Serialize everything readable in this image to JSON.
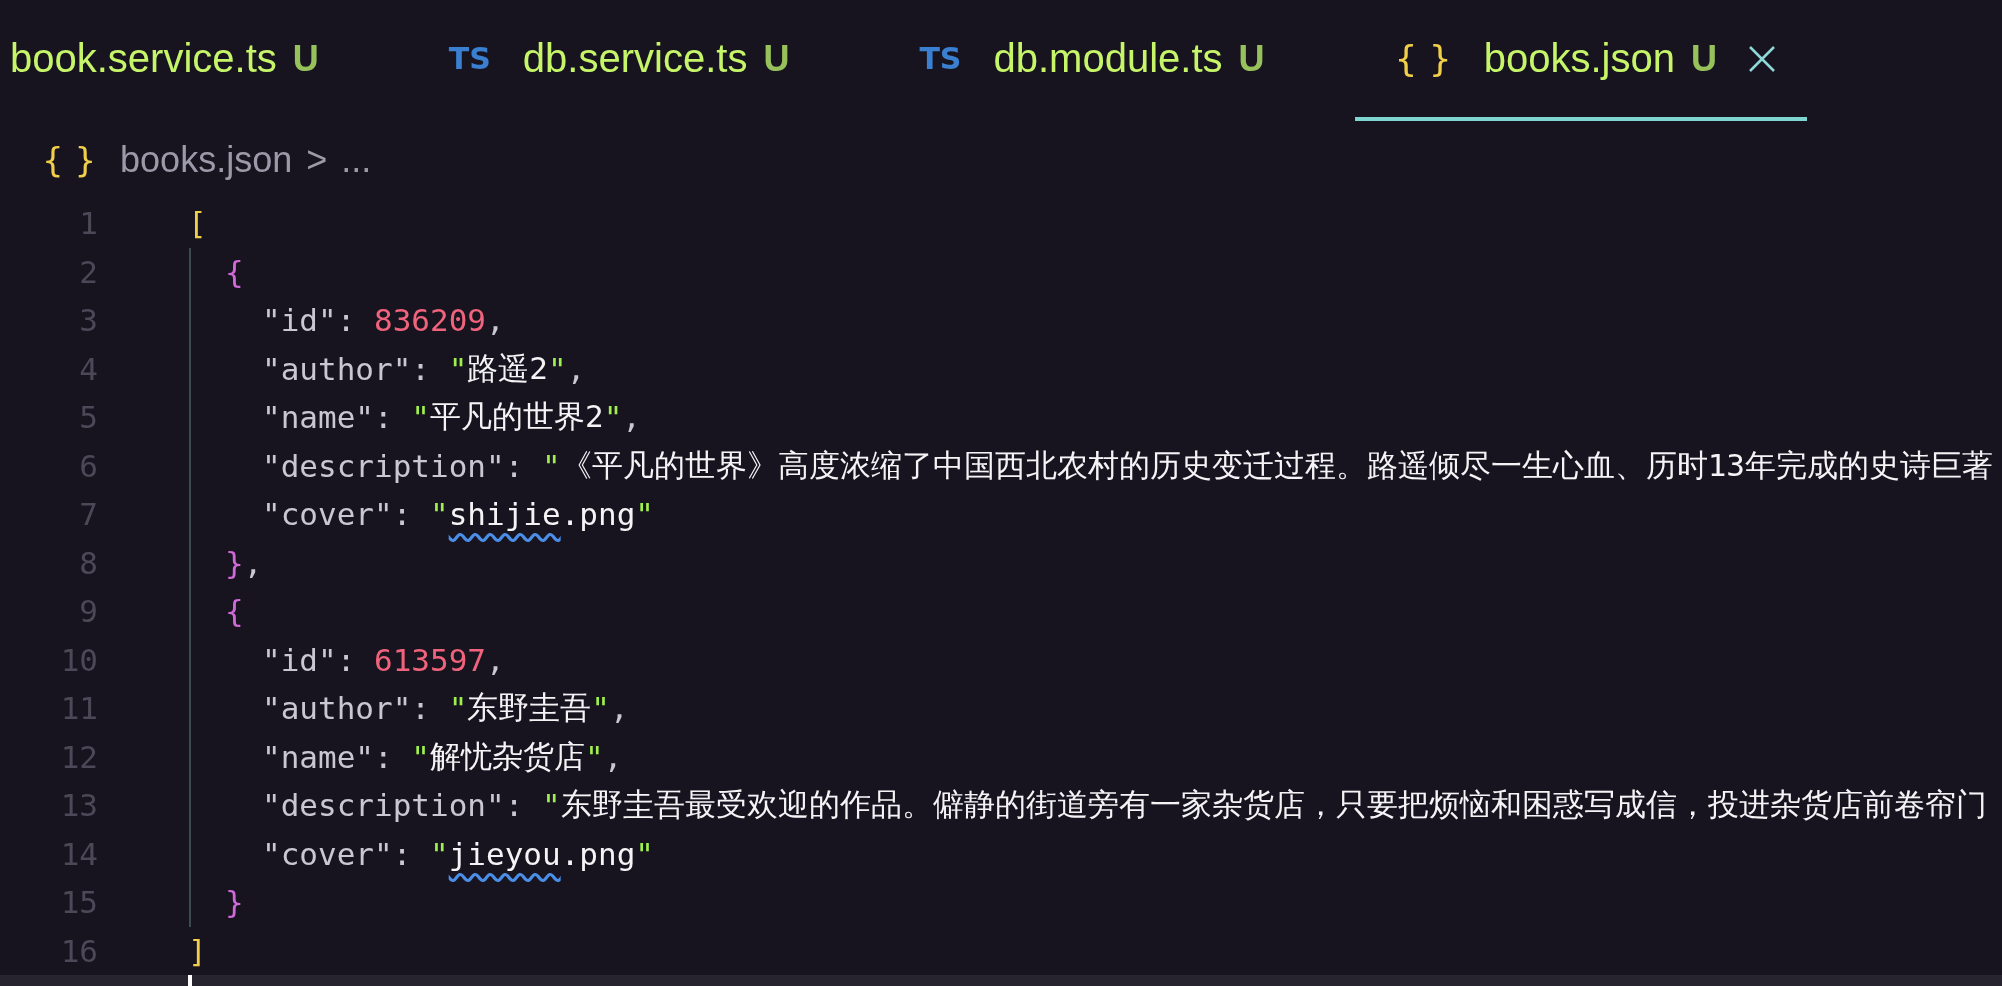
{
  "tabs": [
    {
      "kind": "plain",
      "label": "book.service.ts",
      "badge": "U",
      "selected": false
    },
    {
      "kind": "ts",
      "icon": "TS",
      "label": "db.service.ts",
      "badge": "U",
      "selected": false
    },
    {
      "kind": "ts",
      "icon": "TS",
      "label": "db.module.ts",
      "badge": "U",
      "selected": false
    },
    {
      "kind": "json",
      "icon": "{ }",
      "label": "books.json",
      "badge": "U",
      "selected": true
    }
  ],
  "breadcrumb": {
    "icon": "{ }",
    "file": "books.json",
    "separator": ">",
    "more": "..."
  },
  "code": [
    {
      "kind": "code",
      "number": "1",
      "tokens": [
        {
          "kind": "bracket_outer",
          "text": "["
        }
      ],
      "guide": true,
      "children": [
        {
          "kind": "code",
          "number": "2",
          "tokens": [
            {
              "kind": "bracket_inner",
              "text": "{"
            }
          ],
          "guide": false,
          "children": [
            {
              "kind": "code",
              "number": "3",
              "tokens": [
                {
                  "kind": "key",
                  "text": "\"id\""
                },
                {
                  "kind": "plain",
                  "text": ":"
                },
                {
                  "kind": "number",
                  "text": "836209"
                },
                {
                  "kind": "plain",
                  "text": ","
                }
              ]
            },
            {
              "kind": "code",
              "number": "4",
              "tokens": [
                {
                  "kind": "key",
                  "text": "\"author\""
                },
                {
                  "kind": "plain",
                  "text": ":"
                },
                {
                  "kind": "quote",
                  "text": "\""
                },
                {
                  "kind": "string",
                  "text": "路遥2"
                },
                {
                  "kind": "quote",
                  "text": "\""
                },
                {
                  "kind": "plain",
                  "text": ","
                }
              ]
            },
            {
              "kind": "code",
              "number": "5",
              "tokens": [
                {
                  "kind": "key",
                  "text": "\"name\""
                },
                {
                  "kind": "plain",
                  "text": ":"
                },
                {
                  "kind": "quote",
                  "text": "\""
                },
                {
                  "kind": "string",
                  "text": "平凡的世界2"
                },
                {
                  "kind": "quote",
                  "text": "\""
                },
                {
                  "kind": "plain",
                  "text": ","
                }
              ]
            },
            {
              "kind": "code",
              "number": "6",
              "tokens": [
                {
                  "kind": "key",
                  "text": "\"description\""
                },
                {
                  "kind": "plain",
                  "text": ":"
                },
                {
                  "kind": "quote",
                  "text": "\""
                },
                {
                  "kind": "string",
                  "text": "《平凡的世界》高度浓缩了中国西北农村的历史变迁过程。路遥倾尽一生心血、历时13年完成的史诗巨著"
                }
              ]
            },
            {
              "kind": "code",
              "number": "7",
              "tokens": [
                {
                  "kind": "key",
                  "text": "\"cover\""
                },
                {
                  "kind": "plain",
                  "text": ":"
                },
                {
                  "kind": "quote",
                  "text": "\""
                },
                {
                  "kind": "flagged",
                  "text": "shijie"
                },
                {
                  "kind": "string",
                  "text": ".png"
                },
                {
                  "kind": "quote",
                  "text": "\""
                }
              ]
            }
          ]
        },
        {
          "kind": "code",
          "number": "8",
          "tokens": [
            {
              "kind": "bracket_inner",
              "text": "}"
            },
            {
              "kind": "plain",
              "text": ","
            }
          ]
        },
        {
          "kind": "code",
          "number": "9",
          "tokens": [
            {
              "kind": "bracket_inner",
              "text": "{"
            }
          ],
          "guide": false,
          "children": [
            {
              "kind": "code",
              "number": "10",
              "tokens": [
                {
                  "kind": "key",
                  "text": "\"id\""
                },
                {
                  "kind": "plain",
                  "text": ":"
                },
                {
                  "kind": "number",
                  "text": "613597"
                },
                {
                  "kind": "plain",
                  "text": ","
                }
              ]
            },
            {
              "kind": "code",
              "number": "11",
              "tokens": [
                {
                  "kind": "key",
                  "text": "\"author\""
                },
                {
                  "kind": "plain",
                  "text": ":"
                },
                {
                  "kind": "quote",
                  "text": "\""
                },
                {
                  "kind": "string",
                  "text": "东野圭吾"
                },
                {
                  "kind": "quote",
                  "text": "\""
                },
                {
                  "kind": "plain",
                  "text": ","
                }
              ]
            },
            {
              "kind": "code",
              "number": "12",
              "tokens": [
                {
                  "kind": "key",
                  "text": "\"name\""
                },
                {
                  "kind": "plain",
                  "text": ":"
                },
                {
                  "kind": "quote",
                  "text": "\""
                },
                {
                  "kind": "string",
                  "text": "解忧杂货店"
                },
                {
                  "kind": "quote",
                  "text": "\""
                },
                {
                  "kind": "plain",
                  "text": ","
                }
              ]
            },
            {
              "kind": "code",
              "number": "13",
              "tokens": [
                {
                  "kind": "key",
                  "text": "\"description\""
                },
                {
                  "kind": "plain",
                  "text": ":"
                },
                {
                  "kind": "quote",
                  "text": "\""
                },
                {
                  "kind": "string",
                  "text": "东野圭吾最受欢迎的作品。僻静的街道旁有一家杂货店，只要把烦恼和困惑写成信，投进杂货店前卷帘门"
                }
              ]
            },
            {
              "kind": "code",
              "number": "14",
              "tokens": [
                {
                  "kind": "key",
                  "text": "\"cover\""
                },
                {
                  "kind": "plain",
                  "text": ":"
                },
                {
                  "kind": "quote",
                  "text": "\""
                },
                {
                  "kind": "flagged",
                  "text": "jieyou"
                },
                {
                  "kind": "string",
                  "text": ".png"
                },
                {
                  "kind": "quote",
                  "text": "\""
                }
              ]
            }
          ]
        },
        {
          "kind": "code",
          "number": "15",
          "tokens": [
            {
              "kind": "bracket_inner",
              "text": "}"
            }
          ]
        }
      ]
    },
    {
      "kind": "code",
      "number": "16",
      "tokens": [
        {
          "kind": "bracket_outer",
          "text": "]"
        }
      ]
    },
    {
      "kind": "cursor"
    }
  ]
}
